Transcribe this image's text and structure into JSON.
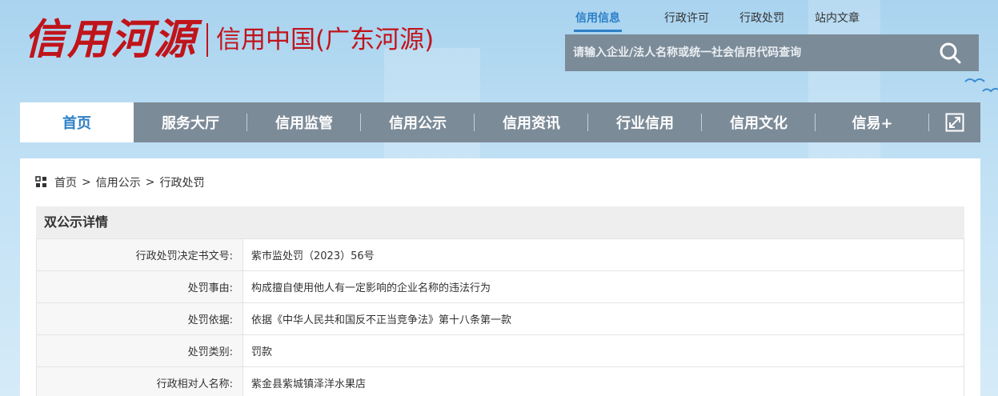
{
  "header": {
    "logo_main": "信用河源",
    "logo_sub": "信用中国(广东河源)",
    "top_links": [
      "信用信息",
      "行政许可",
      "行政处罚",
      "站内文章"
    ],
    "search_placeholder": "请输入企业/法人名称或统一社会信用代码查询"
  },
  "main_nav": [
    "首页",
    "服务大厅",
    "信用监管",
    "信用公示",
    "信用资讯",
    "行业信用",
    "信用文化",
    "信易+"
  ],
  "breadcrumb": [
    "首页",
    "信用公示",
    "行政处罚"
  ],
  "detail": {
    "title": "双公示详情",
    "rows": [
      {
        "label": "行政处罚决定书文号:",
        "value": "紫市监处罚（2023）56号"
      },
      {
        "label": "处罚事由:",
        "value": "构成擅自使用他人有一定影响的企业名称的违法行为"
      },
      {
        "label": "处罚依据:",
        "value": "依据《中华人民共和国反不正当竞争法》第十八条第一款"
      },
      {
        "label": "处罚类别:",
        "value": "罚款"
      },
      {
        "label": "行政相对人名称:",
        "value": "紫金县紫城镇泽洋水果店"
      }
    ]
  },
  "colors": {
    "brand_red": "#c0141b",
    "accent_blue": "#2c7fc7",
    "nav_gray": "#7c8b98"
  }
}
